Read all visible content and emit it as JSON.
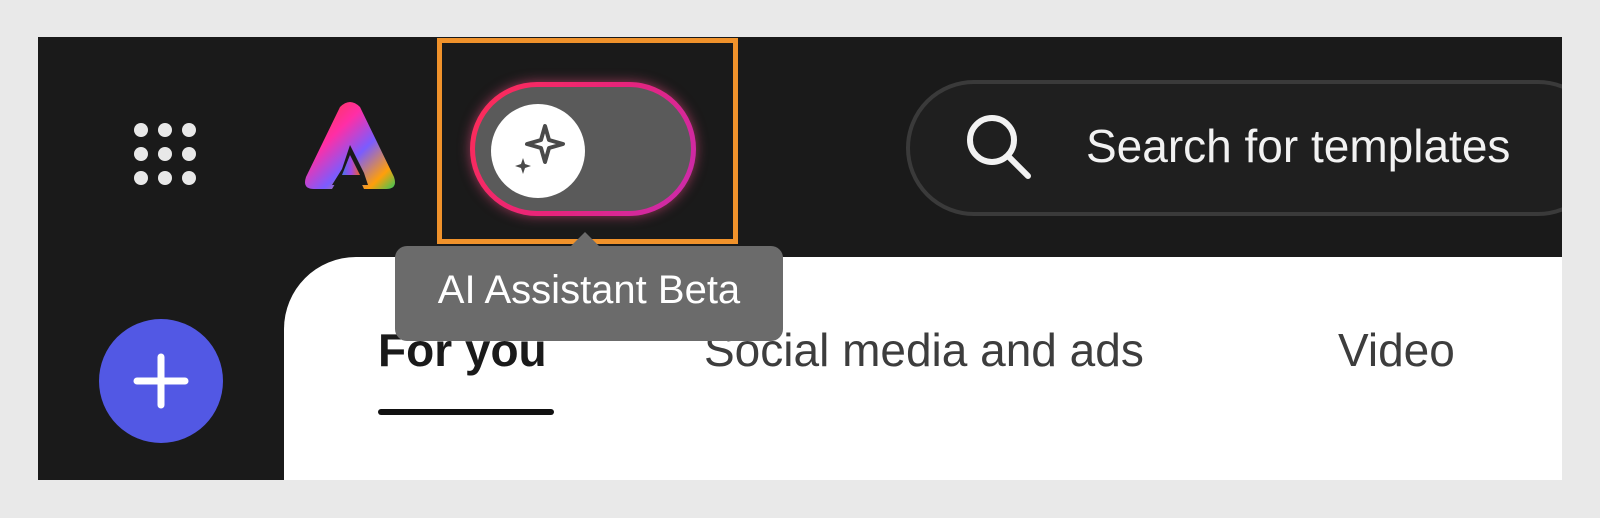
{
  "header": {
    "apps_icon": "apps-grid-icon",
    "logo": "adobe-express-logo",
    "ai_toggle": {
      "icon": "sparkle-icon",
      "state": "off"
    },
    "search": {
      "icon": "search-icon",
      "placeholder": "Search for templates"
    }
  },
  "tooltip": {
    "text": "AI Assistant Beta"
  },
  "sidebar": {
    "add_button_icon": "plus-icon"
  },
  "main": {
    "tabs": [
      {
        "label": "For you",
        "active": true
      },
      {
        "label": "Social media and ads",
        "active": false
      },
      {
        "label": "Video",
        "active": false
      }
    ]
  },
  "colors": {
    "highlight": "#f0922b",
    "add_button": "#5258e4",
    "toggle_ring_start": "#ff2d55",
    "toggle_ring_end": "#c92bb0"
  }
}
